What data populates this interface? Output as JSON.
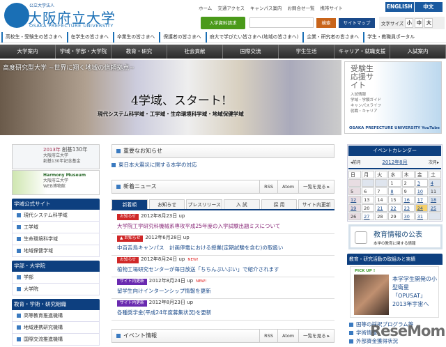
{
  "header": {
    "logo_sub": "公立大学法人",
    "logo_main": "大阪府立大学",
    "logo_en": "OSAKA PREFECTURE UNIVERSITY",
    "top_links": [
      "ホーム",
      "交通アクセス",
      "キャンパス案内",
      "お問合せ一覧",
      "携帯サイト"
    ],
    "lang": [
      "ENGLISH",
      "中文"
    ],
    "request_button": "入学資料請求",
    "search_placeholder": "",
    "search_button": "検索",
    "sitemap_button": "サイトマップ",
    "font_size_label": "文字サイズ",
    "font_sizes": [
      "小",
      "中",
      "大"
    ]
  },
  "audience_nav": [
    "高校生・受験生の皆さまへ",
    "在学生の皆さまへ",
    "卒業生の皆さまへ",
    "保護者の皆さまへ",
    "府大で学びたい皆さまへ(地域の皆さまへ)",
    "企業・研究者の皆さまへ",
    "学生・教職員ポータル"
  ],
  "global_nav": [
    "大学案内",
    "学域・学部・大学院",
    "教育・研究",
    "社会貢献",
    "国際交流",
    "学生生活",
    "キャリア・就職支援",
    "入試案内"
  ],
  "hero": {
    "tagline": "高度研究型大学 ~世界に翔く地域の信頼拠点~",
    "title": "4学域、スタート!",
    "subtitle": "現代システム科学域・工学域・生命環境科学域・地域保健学域"
  },
  "side_banner": {
    "title": "受験生応援サイト",
    "items": [
      "入試情報",
      "学域・学類ガイド",
      "キャンパスライフ",
      "就職・キャリア"
    ],
    "footer": "OSAKA PREFECTURE UNIVERSITY YouTube"
  },
  "left": {
    "banner1": {
      "year": "2013年",
      "line1": "創基130年",
      "line2": "大阪府立大学",
      "line3": "創基130年記念基金"
    },
    "banner2": {
      "brand": "Harmony Museum",
      "line1": "大阪府立大学",
      "line2": "WEB博物館"
    },
    "sections": [
      {
        "title": "学域公式サイト",
        "items": [
          "現代システム科学域",
          "工学域",
          "生命環境科学域",
          "地域保健学域"
        ]
      },
      {
        "title": "学部・大学院",
        "items": [
          "学部",
          "大学院"
        ]
      },
      {
        "title": "教育・学術・研究組織",
        "items": [
          "高等教育推進機構",
          "地域連携研究機構",
          "国際交流推進機構"
        ]
      }
    ]
  },
  "main": {
    "important_title": "重要なお知らせ",
    "important_link": "東日本大震災に関する本学の対応",
    "news_title": "新着ニュース",
    "rss": "RSS",
    "atom": "Atom",
    "list_link": "一覧を見る ▸",
    "tabs": [
      "新着順",
      "お知らせ",
      "プレスリリース",
      "入 試",
      "採 用",
      "サイト内更新"
    ],
    "news": [
      {
        "tag": "お知らせ",
        "tag_color": "#d02828",
        "date": "2012年8月23日 up",
        "new": "",
        "title": "大学院工学研究科機械系専攻平成25年度の入学試験出題ミスについて",
        "title_color": "#8a2a7a"
      },
      {
        "tag": "▲ お知らせ",
        "tag_color": "#d02828",
        "date": "2012年6月28日 up",
        "new": "",
        "title": "中百舌鳥キャンパス　計画停電における授業(定期試験を含む)の取扱い",
        "title_color": "#1a4a8a"
      },
      {
        "tag": "お知らせ",
        "tag_color": "#d02828",
        "date": "2012年8月24日 up",
        "new": "NEW!",
        "title": "植物工場研究センターが毎日放送「ちちんぷいぷい」で紹介されます",
        "title_color": "#1a4a8a"
      },
      {
        "tag": "サイト内更新",
        "tag_color": "#6a2ab0",
        "date": "2012年8月24日 up",
        "new": "NEW!",
        "title": "留学生向けインターンシップ情報を更新",
        "title_color": "#1a4a8a"
      },
      {
        "tag": "サイト内更新",
        "tag_color": "#6a2ab0",
        "date": "2012年8月23日 up",
        "new": "",
        "title": "各種奨学金(平成24年度募集状況)を更新",
        "title_color": "#1a4a8a"
      }
    ],
    "event_title": "イベント情報"
  },
  "calendar": {
    "title": "イベントカレンダー",
    "prev": "◂前月",
    "month": "2012年8月",
    "next": "次月▸",
    "weekdays": [
      "日",
      "月",
      "火",
      "水",
      "木",
      "金",
      "土"
    ],
    "first_weekday": 3,
    "days": 31,
    "today": 24,
    "linked": [
      3,
      4,
      8,
      10,
      12,
      16,
      17,
      18,
      19,
      21,
      22,
      23,
      24,
      25,
      27,
      30,
      31
    ]
  },
  "right": {
    "pub_title": "教育情報の公表",
    "pub_sub": "本学の教育に関する情報",
    "activity_title": "教育・研究活動の取組みと実績",
    "pickup_label": "PICK UP !",
    "pickup_text": "本学学生開発の小型衛星「OPUSAT」2013年宇宙へ",
    "links": [
      "国等の採択プログラム等",
      "学術情報",
      "外部資金獲得状況"
    ]
  },
  "watermark": "ReseMom"
}
